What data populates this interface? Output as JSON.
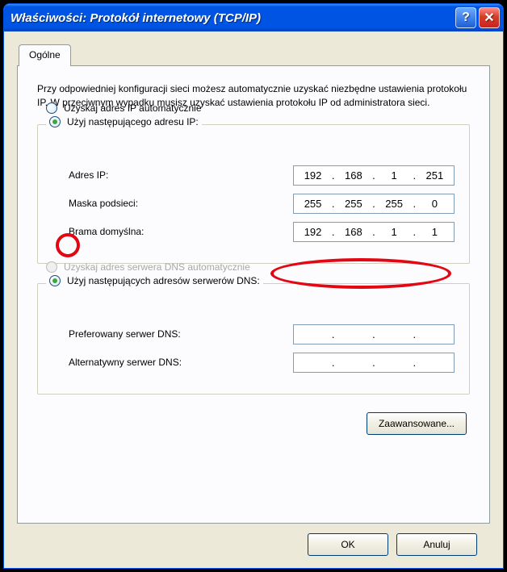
{
  "window": {
    "title": "Właściwości: Protokół internetowy (TCP/IP)"
  },
  "tab": {
    "label": "Ogólne"
  },
  "intro": "Przy odpowiedniej konfiguracji sieci możesz automatycznie uzyskać niezbędne ustawienia protokołu IP. W przeciwnym wypadku musisz uzyskać ustawienia protokołu IP od administratora sieci.",
  "ip_section": {
    "radio_auto": "Uzyskaj adres IP automatycznie",
    "radio_manual": "Użyj następującego adresu IP:",
    "fields": {
      "ip_label": "Adres IP:",
      "ip": [
        "192",
        "168",
        "1",
        "251"
      ],
      "mask_label": "Maska podsieci:",
      "mask": [
        "255",
        "255",
        "255",
        "0"
      ],
      "gw_label": "Brama domyślna:",
      "gw": [
        "192",
        "168",
        "1",
        "1"
      ]
    }
  },
  "dns_section": {
    "radio_auto": "Uzyskaj adres serwera DNS automatycznie",
    "radio_manual": "Użyj następujących adresów serwerów DNS:",
    "fields": {
      "pref_label": "Preferowany serwer DNS:",
      "pref": [
        "",
        "",
        "",
        ""
      ],
      "alt_label": "Alternatywny serwer DNS:",
      "alt": [
        "",
        "",
        "",
        ""
      ]
    }
  },
  "buttons": {
    "advanced": "Zaawansowane...",
    "ok": "OK",
    "cancel": "Anuluj"
  }
}
